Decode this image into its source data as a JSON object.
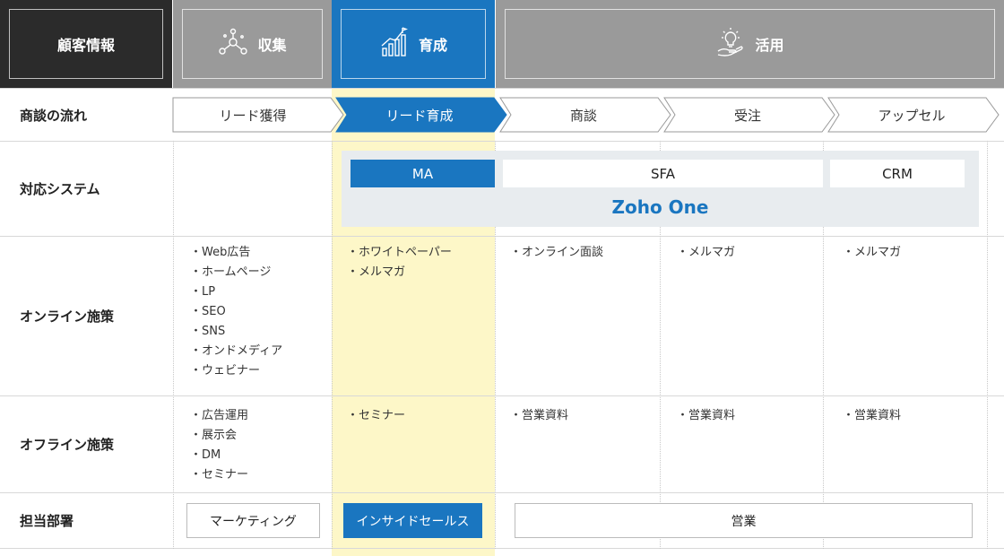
{
  "header": {
    "customer_info": "顧客情報",
    "collect": "収集",
    "nurture": "育成",
    "utilize": "活用"
  },
  "rows": {
    "flow": "商談の流れ",
    "system": "対応システム",
    "online": "オンライン施策",
    "offline": "オフライン施策",
    "dept": "担当部署"
  },
  "flow_steps": [
    "リード獲得",
    "リード育成",
    "商談",
    "受注",
    "アップセル"
  ],
  "systems": {
    "ma": "MA",
    "sfa": "SFA",
    "crm": "CRM",
    "zoho": "Zoho One"
  },
  "online": {
    "col1": [
      "Web広告",
      "ホームページ",
      "LP",
      "SEO",
      "SNS",
      "オンドメディア",
      "ウェビナー"
    ],
    "col2": [
      "ホワイトペーパー",
      "メルマガ"
    ],
    "col3": [
      "オンライン面談"
    ],
    "col4": [
      "メルマガ"
    ],
    "col5": [
      "メルマガ"
    ]
  },
  "offline": {
    "col1": [
      "広告運用",
      "展示会",
      "DM",
      "セミナー"
    ],
    "col2": [
      "セミナー"
    ],
    "col3": [
      "営業資料"
    ],
    "col4": [
      "営業資料"
    ],
    "col5": [
      "営業資料"
    ]
  },
  "departments": {
    "marketing": "マーケティング",
    "inside_sales": "インサイドセールス",
    "sales": "営業"
  },
  "colors": {
    "dark": "#2b2b2b",
    "gray": "#9a9a9a",
    "blue": "#1a76c0",
    "highlight": "#fdf7c8",
    "system_bg": "#e8ecef"
  },
  "icons": {
    "collect": "molecule-icon",
    "nurture": "growth-chart-icon",
    "utilize": "hand-lightbulb-icon"
  }
}
